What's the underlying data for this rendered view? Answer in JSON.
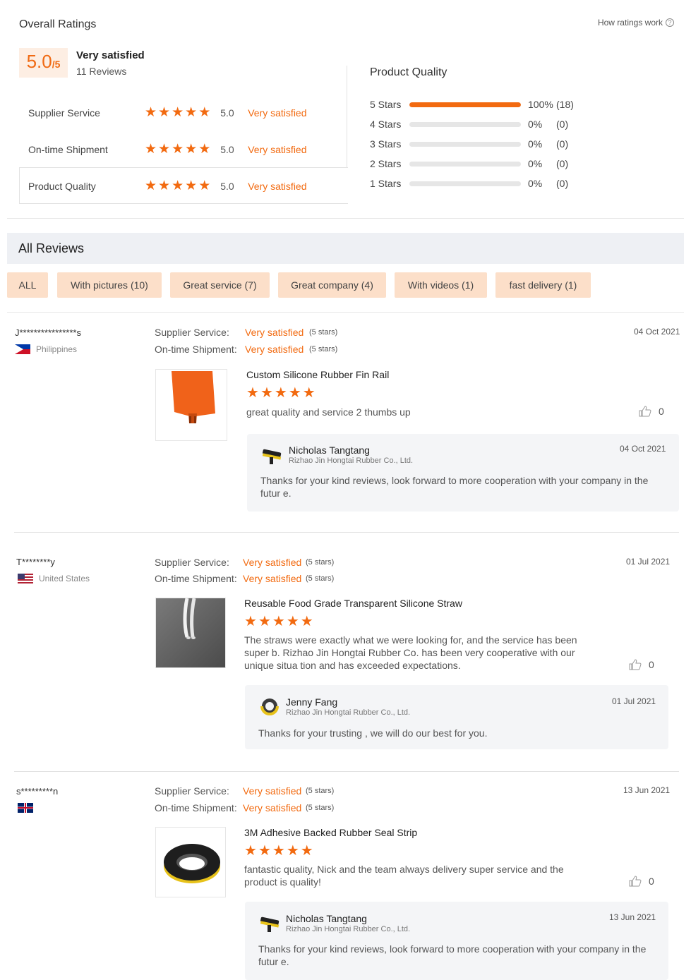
{
  "summary": {
    "title": "Overall Ratings",
    "how_ratings_work": "How ratings work",
    "score": "5.0",
    "score_suffix": "/5",
    "score_label": "Very satisfied",
    "reviews_count": "11 Reviews",
    "categories": [
      {
        "label": "Supplier Service",
        "value": "5.0",
        "text": "Very satisfied",
        "stars": 5
      },
      {
        "label": "On-time Shipment",
        "value": "5.0",
        "text": "Very satisfied",
        "stars": 5
      },
      {
        "label": "Product Quality",
        "value": "5.0",
        "text": "Very satisfied",
        "stars": 5
      }
    ]
  },
  "breakdown": {
    "title": "Product Quality",
    "rows": [
      {
        "label": "5  Stars",
        "percent": "100%",
        "count": "(18)",
        "fill": 1.0
      },
      {
        "label": "4  Stars",
        "percent": "0%",
        "count": "(0)",
        "fill": 0
      },
      {
        "label": "3  Stars",
        "percent": "0%",
        "count": "(0)",
        "fill": 0
      },
      {
        "label": "2  Stars",
        "percent": "0%",
        "count": "(0)",
        "fill": 0
      },
      {
        "label": "1  Stars",
        "percent": "0%",
        "count": "(0)",
        "fill": 0
      }
    ]
  },
  "all_reviews": {
    "title": "All Reviews",
    "filters": [
      "ALL",
      "With pictures (10)",
      "Great service (7)",
      "Great company (4)",
      "With videos (1)",
      "fast delivery (1)"
    ]
  },
  "labels": {
    "supplier_service": "Supplier Service:",
    "ontime_shipment": "On-time Shipment:",
    "very_satisfied": "Very satisfied",
    "five_stars": "(5 stars)"
  },
  "reviews": [
    {
      "name": "J****************s",
      "country": "Philippines",
      "date": "04 Oct 2021",
      "product": "Custom Silicone Rubber Fin Rail",
      "text": "great quality and service 2 thumbs up",
      "likes": "0",
      "reply": {
        "name": "Nicholas Tangtang",
        "company": "Rizhao Jin Hongtai Rubber Co., Ltd.",
        "date": "04 Oct 2021",
        "text": "Thanks for your kind reviews, look forward to more cooperation with your company in the futur e."
      }
    },
    {
      "name": "T********y",
      "country": "United States",
      "date": "01 Jul 2021",
      "product": "Reusable Food Grade Transparent Silicone Straw",
      "text": "The straws were exactly what we were looking for, and the service has been super b. Rizhao Jin Hongtai Rubber Co. has been very cooperative with our unique situa tion and has exceeded expectations.",
      "likes": "0",
      "reply": {
        "name": "Jenny Fang",
        "company": "Rizhao Jin Hongtai Rubber Co., Ltd.",
        "date": "01 Jul 2021",
        "text": "Thanks for your trusting , we will do our best for you."
      }
    },
    {
      "name": "s*********n",
      "country": "",
      "date": "13 Jun 2021",
      "product": "3M Adhesive Backed Rubber Seal Strip",
      "text": "fantastic quality, Nick and the team always delivery super service and the product is quality!",
      "likes": "0",
      "reply": {
        "name": "Nicholas Tangtang",
        "company": "Rizhao Jin Hongtai Rubber Co., Ltd.",
        "date": "13 Jun 2021",
        "text": "Thanks for your kind reviews, look forward to more cooperation with your company in the futur e."
      }
    }
  ],
  "colors": {
    "accent": "#f26a10",
    "tag_bg": "#fcdfc9",
    "reply_bg": "#f4f5f7"
  }
}
